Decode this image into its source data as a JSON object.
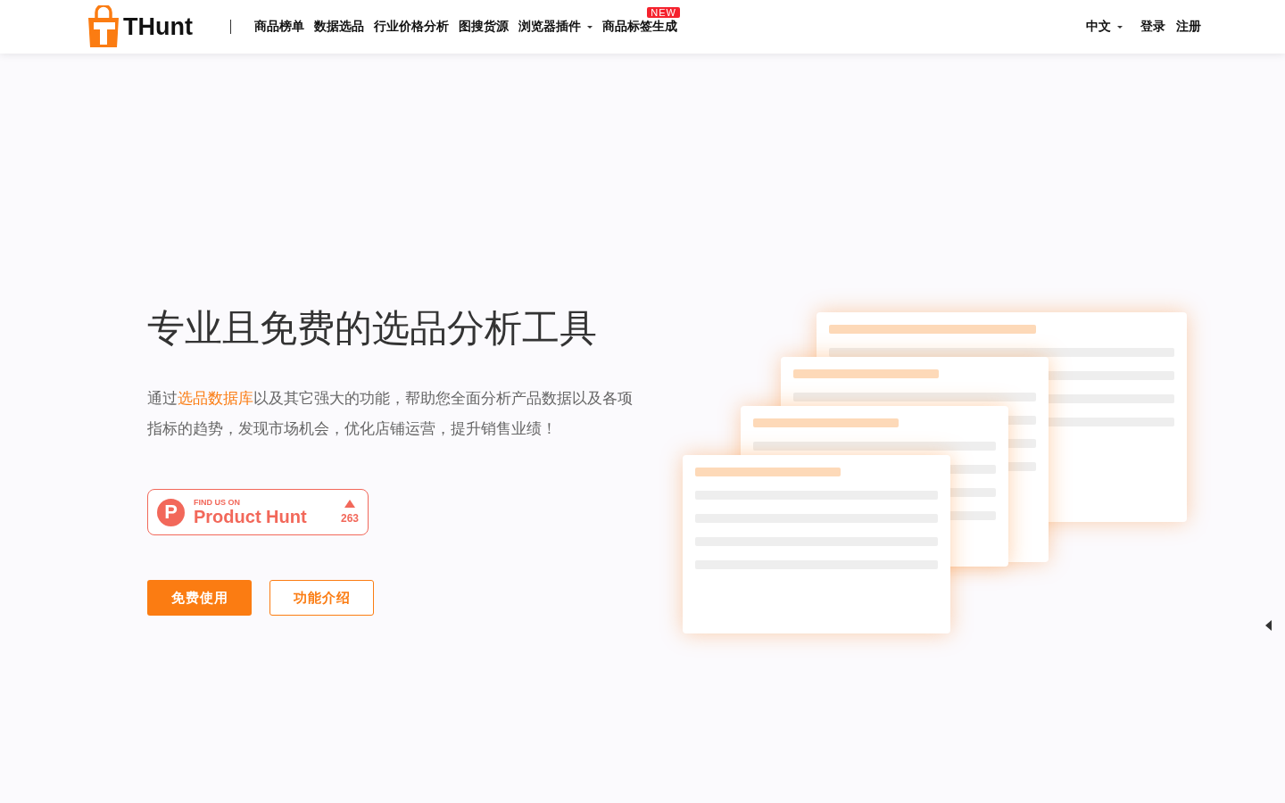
{
  "header": {
    "logo_text": "THunt",
    "nav": [
      {
        "label": "商品榜单",
        "dropdown": false
      },
      {
        "label": "数据选品",
        "dropdown": false
      },
      {
        "label": "行业价格分析",
        "dropdown": false
      },
      {
        "label": "图搜货源",
        "dropdown": false
      },
      {
        "label": "浏览器插件",
        "dropdown": true
      },
      {
        "label": "商品标签生成",
        "dropdown": false,
        "badge": "NEW"
      }
    ],
    "language": "中文",
    "login": "登录",
    "register": "注册"
  },
  "hero": {
    "title": "专业且免费的选品分析工具",
    "description_parts": [
      {
        "text": "通过",
        "link": false
      },
      {
        "text": "选品数据库",
        "link": true
      },
      {
        "text": "以及其它强大的功能，帮助您全面分析产品数据以及各项指标的趋势，发现市场机会，优化店铺运营，提升销售业绩！",
        "link": false
      }
    ],
    "product_hunt": {
      "logo_letter": "P",
      "caption": "FIND US ON",
      "name": "Product Hunt",
      "votes": "263"
    },
    "buttons": [
      {
        "label": "免费使用",
        "kind": "primary"
      },
      {
        "label": "功能介绍",
        "kind": "outline"
      }
    ]
  }
}
